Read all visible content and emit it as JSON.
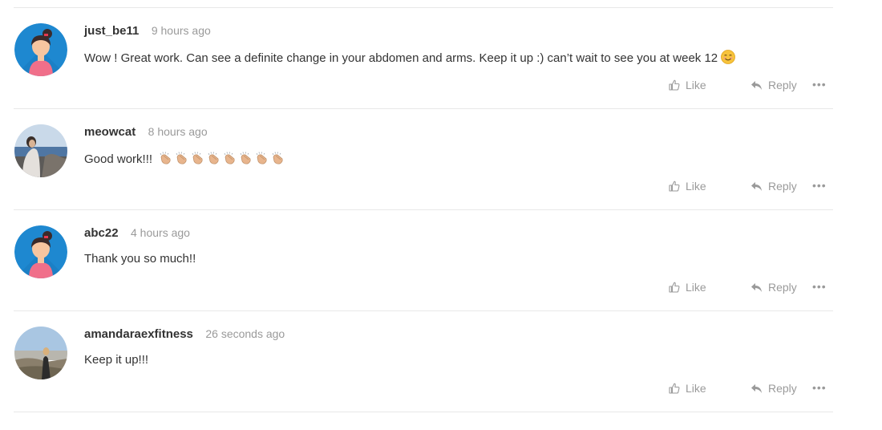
{
  "comments": [
    {
      "username": "just_be11",
      "time": "9 hours ago",
      "text": "Wow ! Great work. Can see a definite change in your abdomen and arms. Keep it up :) can’t wait to see you at week 12",
      "emoji": "smiling-face",
      "avatar": "default-avatar-girl",
      "like_label": "Like",
      "reply_label": "Reply",
      "more_label": "•••"
    },
    {
      "username": "meowcat",
      "time": "8 hours ago",
      "text": "Good work!!!",
      "emoji": "clapping-hands",
      "emoji_count": 8,
      "avatar": "photo-beach",
      "like_label": "Like",
      "reply_label": "Reply",
      "more_label": "•••"
    },
    {
      "username": "abc22",
      "time": "4 hours ago",
      "text": "Thank you so much!!",
      "avatar": "default-avatar-girl",
      "like_label": "Like",
      "reply_label": "Reply",
      "more_label": "•••"
    },
    {
      "username": "amandaraexfitness",
      "time": "26 seconds ago",
      "text": "Keep it up!!!",
      "avatar": "photo-hilltop",
      "like_label": "Like",
      "reply_label": "Reply",
      "more_label": "•••"
    }
  ],
  "colors": {
    "username": "#333333",
    "muted": "#9a9a9a",
    "divider": "#e8e8e8",
    "avatar_bg": "#1e88d0"
  }
}
